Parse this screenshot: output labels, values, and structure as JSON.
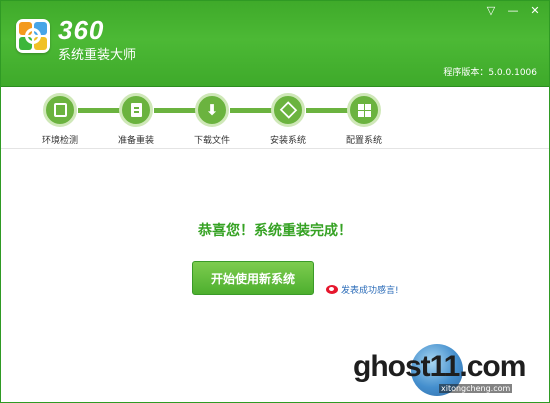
{
  "header": {
    "brand_number": "360",
    "brand_name": "系统重装大师",
    "version": "程序版本：5.0.0.1006",
    "controls": {
      "menu": "▽",
      "minimize": "—",
      "close": "✕"
    }
  },
  "steps": [
    {
      "label": "环境检测",
      "icon": "document-check-icon"
    },
    {
      "label": "准备重装",
      "icon": "clipboard-icon"
    },
    {
      "label": "下载文件",
      "icon": "download-icon"
    },
    {
      "label": "安装系统",
      "icon": "package-icon"
    },
    {
      "label": "配置系统",
      "icon": "windows-logo-icon"
    }
  ],
  "main": {
    "message": "恭喜您！系统重装完成！",
    "primary_button": "开始使用新系统",
    "feedback_link": "发表成功感言!"
  },
  "watermark": {
    "text": "ghost11.com",
    "sub": "xitongcheng.com"
  },
  "colors": {
    "header_green": "#46b231",
    "step_green": "#6bb33f",
    "message_green": "#36a224",
    "link_blue": "#2a6bb8"
  }
}
